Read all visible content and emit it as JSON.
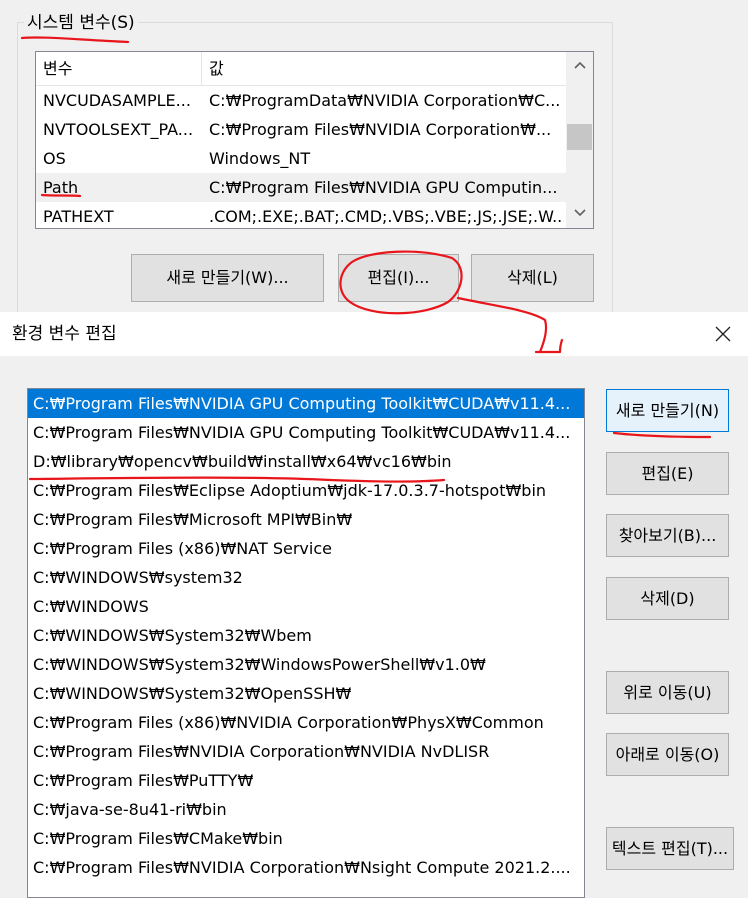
{
  "system_vars": {
    "title": "시스템 변수(S)",
    "col_name": "변수",
    "col_value": "값",
    "rows": [
      {
        "name": "NVCUDASAMPLE...",
        "value": "C:₩ProgramData₩NVIDIA Corporation₩C..."
      },
      {
        "name": "NVTOOLSEXT_PA...",
        "value": "C:₩Program Files₩NVIDIA Corporation₩..."
      },
      {
        "name": "OS",
        "value": "Windows_NT"
      },
      {
        "name": "Path",
        "value": "C:₩Program Files₩NVIDIA GPU Computin..."
      },
      {
        "name": "PATHEXT",
        "value": ".COM;.EXE;.BAT;.CMD;.VBS;.VBE;.JS;.JSE;.W..."
      }
    ],
    "buttons": {
      "new": "새로 만들기(W)...",
      "edit": "편집(I)...",
      "delete": "삭제(L)"
    }
  },
  "dialog": {
    "title": "환경 변수 편집",
    "close_glyph": "✕",
    "paths": [
      "C:₩Program Files₩NVIDIA GPU Computing Toolkit₩CUDA₩v11.4...",
      "C:₩Program Files₩NVIDIA GPU Computing Toolkit₩CUDA₩v11.4...",
      "D:₩library₩opencv₩build₩install₩x64₩vc16₩bin",
      "C:₩Program Files₩Eclipse Adoptium₩jdk-17.0.3.7-hotspot₩bin",
      "C:₩Program Files₩Microsoft MPI₩Bin₩",
      "C:₩Program Files (x86)₩NAT Service",
      "C:₩WINDOWS₩system32",
      "C:₩WINDOWS",
      "C:₩WINDOWS₩System32₩Wbem",
      "C:₩WINDOWS₩System32₩WindowsPowerShell₩v1.0₩",
      "C:₩WINDOWS₩System32₩OpenSSH₩",
      "C:₩Program Files (x86)₩NVIDIA Corporation₩PhysX₩Common",
      "C:₩Program Files₩NVIDIA Corporation₩NVIDIA NvDLISR",
      "C:₩Program Files₩PuTTY₩",
      "C:₩java-se-8u41-ri₩bin",
      "C:₩Program Files₩CMake₩bin",
      "C:₩Program Files₩NVIDIA Corporation₩Nsight Compute 2021.2...."
    ],
    "buttons": {
      "new": "새로 만들기(N)",
      "edit": "편집(E)",
      "browse": "찾아보기(B)...",
      "delete": "삭제(D)",
      "move_up": "위로 이동(U)",
      "move_down": "아래로 이동(O)",
      "edit_text": "텍스트 편집(T)..."
    }
  },
  "colors": {
    "selection": "#0078d7",
    "annotation": "#e8151b"
  }
}
